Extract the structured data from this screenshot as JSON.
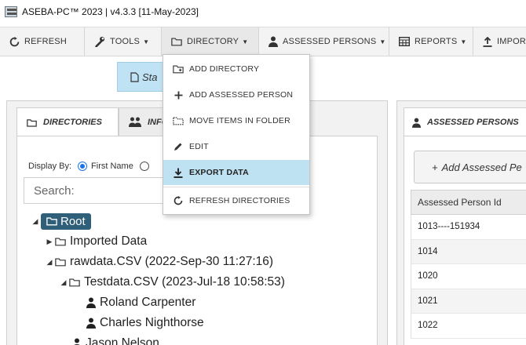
{
  "window": {
    "title": "ASEBA-PC™ 2023 | v4.3.3 [11-May-2023]"
  },
  "toolbar": {
    "refresh": "REFRESH",
    "tools": "TOOLS",
    "directory": "DIRECTORY",
    "assessed_persons": "ASSESSED PERSONS",
    "reports": "REPORTS",
    "import": "IMPOR"
  },
  "start_button": "Sta",
  "directory_menu": {
    "items": [
      "ADD DIRECTORY",
      "ADD ASSESSED PERSON",
      "MOVE ITEMS IN FOLDER",
      "EDIT",
      "EXPORT DATA",
      "REFRESH DIRECTORIES"
    ],
    "highlighted_index": 4
  },
  "left_panel": {
    "tabs": [
      "DIRECTORIES",
      "INFO"
    ],
    "display_by_label": "Display By:",
    "display_by_option": "First Name",
    "search_placeholder": "Search:",
    "tree": [
      {
        "label": "Root",
        "type": "root"
      },
      {
        "label": "Imported Data",
        "type": "folder"
      },
      {
        "label": "rawdata.CSV (2022-Sep-30 11:27:16)",
        "type": "folder"
      },
      {
        "label": "Testdata.CSV (2023-Jul-18 10:58:53)",
        "type": "folder"
      },
      {
        "label": "Roland Carpenter",
        "type": "person"
      },
      {
        "label": "Charles Nighthorse",
        "type": "person"
      },
      {
        "label": "Jason Nelson",
        "type": "person"
      }
    ]
  },
  "right_panel": {
    "tab": "ASSESSED PERSONS",
    "add_button": "Add Assessed Pe",
    "column_header": "Assessed Person Id",
    "rows": [
      "1013----151934",
      "1014",
      "1020",
      "1021",
      "1022"
    ]
  },
  "colors": {
    "highlight": "#bfe2f2",
    "root_badge": "#2f5f79",
    "radio_accent": "#1a73e8"
  }
}
